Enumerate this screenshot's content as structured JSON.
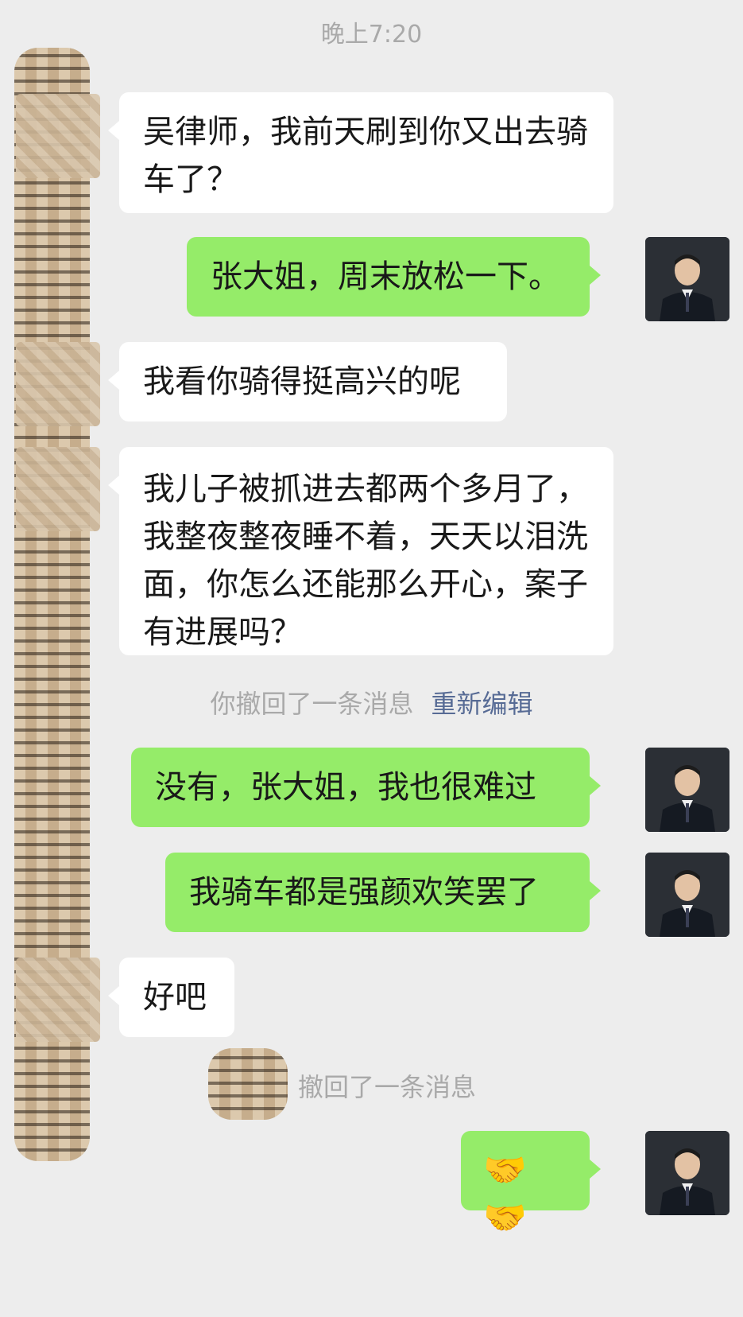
{
  "timestamp": "晚上7:20",
  "messages": [
    {
      "dir": "in",
      "text": "吴律师，我前天刷到你又出去骑车了？"
    },
    {
      "dir": "out",
      "text": "张大姐，周末放松一下。"
    },
    {
      "dir": "in",
      "text": "我看你骑得挺高兴的呢"
    },
    {
      "dir": "in",
      "text": "我儿子被抓进去都两个多月了，我整夜整夜睡不着，天天以泪洗面，你怎么还能那么开心，案子有进展吗？"
    },
    {
      "dir": "out",
      "text": "没有，张大姐，我也很难过"
    },
    {
      "dir": "out",
      "text": "我骑车都是强颜欢笑罢了"
    },
    {
      "dir": "in",
      "text": "好吧"
    },
    {
      "dir": "out",
      "text": "🤝🤝"
    }
  ],
  "system": {
    "recall_self": "你撤回了一条消息",
    "reedit": "重新编辑",
    "recall_other": "撤回了一条消息"
  },
  "icons": {
    "avatar_in": "blurred-contact-avatar",
    "avatar_out": "lawyer-portrait-avatar",
    "emoji": "handshake-emoji"
  },
  "colors": {
    "background": "#ededed",
    "incoming_bubble": "#ffffff",
    "outgoing_bubble": "#95ec69",
    "system_text": "#a9a9a9",
    "link": "#576b95"
  }
}
